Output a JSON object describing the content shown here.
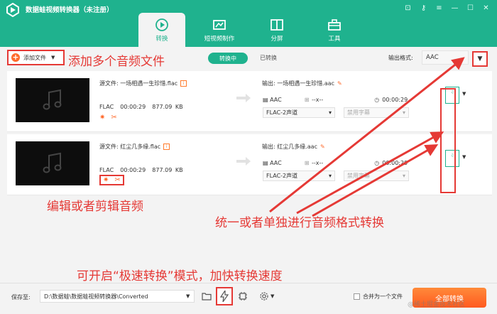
{
  "app": {
    "title": "数据蛙视频转换器（未注册）"
  },
  "window_controls": [
    "gift-icon",
    "key-icon",
    "menu-icon",
    "minimize-icon",
    "maximize-icon",
    "close-icon"
  ],
  "tabs": [
    {
      "label": "转换",
      "icon": "convert-icon",
      "active": true
    },
    {
      "label": "短视频制作",
      "icon": "film-icon",
      "active": false
    },
    {
      "label": "分屏",
      "icon": "split-screen-icon",
      "active": false
    },
    {
      "label": "工具",
      "icon": "toolbox-icon",
      "active": false
    }
  ],
  "toolbar": {
    "add_file": "添加文件",
    "converting": "转换中",
    "converted": "已转换",
    "output_format_label": "输出格式:",
    "output_format_value": "AAC"
  },
  "files": [
    {
      "source": "源文件: 一场相遇一生珍惜.flac",
      "format": "FLAC",
      "duration": "00:00:29",
      "size": "877.09 KB",
      "output": "输出: 一场相遇一生珍惜.aac",
      "out_format": "AAC",
      "out_res": "--x--",
      "out_time": "00:00:29",
      "channel": "FLAC-2声道",
      "subtitle": "禁用字幕"
    },
    {
      "source": "源文件: 红尘几多缘.flac",
      "format": "FLAC",
      "duration": "00:00:29",
      "size": "877.09 KB",
      "output": "输出: 红尘几多缘.aac",
      "out_format": "AAC",
      "out_res": "--x--",
      "out_time": "00:00:29",
      "channel": "FLAC-2声道",
      "subtitle": "禁用字幕"
    }
  ],
  "annotations": {
    "add_multi": "添加多个音频文件",
    "edit_cut": "编辑或者剪辑音频",
    "unify": "统一或者单独进行音频格式转换",
    "speed": "可开启“极速转换”模式，加快转换速度"
  },
  "bottom": {
    "save_to": "保存至:",
    "path": "D:\\数据蛙\\数据蛙视频转换器\\Converted",
    "merge": "合并为一个文件",
    "convert_all": "全部转换"
  },
  "watermark": "@稀土掘金技术社区",
  "colors": {
    "accent": "#1fb28e",
    "orange": "#ff6a2b",
    "annotation": "#e53935"
  }
}
